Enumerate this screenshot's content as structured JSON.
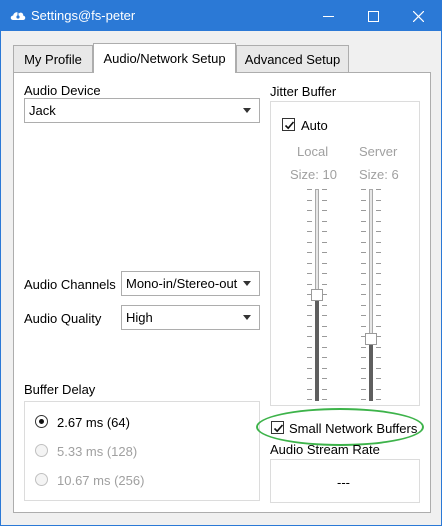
{
  "window": {
    "title": "Settings@fs-peter",
    "icon": "cloud-guitar-icon",
    "accent_color": "#2b79d6"
  },
  "tabs": [
    {
      "label": "My Profile",
      "active": false
    },
    {
      "label": "Audio/Network Setup",
      "active": true
    },
    {
      "label": "Advanced Setup",
      "active": false
    }
  ],
  "audio_device": {
    "label": "Audio Device",
    "value": "Jack"
  },
  "audio_channels": {
    "label": "Audio Channels",
    "value": "Mono-in/Stereo-out"
  },
  "audio_quality": {
    "label": "Audio Quality",
    "value": "High"
  },
  "buffer_delay": {
    "label": "Buffer Delay",
    "options": [
      {
        "label": "2.67 ms (64)",
        "selected": true,
        "enabled": true
      },
      {
        "label": "5.33 ms (128)",
        "selected": false,
        "enabled": false
      },
      {
        "label": "10.67 ms (256)",
        "selected": false,
        "enabled": false
      }
    ]
  },
  "jitter_buffer": {
    "label": "Jitter Buffer",
    "auto_label": "Auto",
    "auto_checked": true,
    "local_label": "Local",
    "server_label": "Server",
    "local_size": "Size: 10",
    "server_size": "Size: 6",
    "local_level": 0.5,
    "server_level": 0.28
  },
  "small_network_buffers": {
    "label": "Small Network Buffers",
    "checked": true,
    "highlight_color": "#3db34a"
  },
  "audio_stream_rate": {
    "label": "Audio Stream Rate",
    "value": "---"
  }
}
